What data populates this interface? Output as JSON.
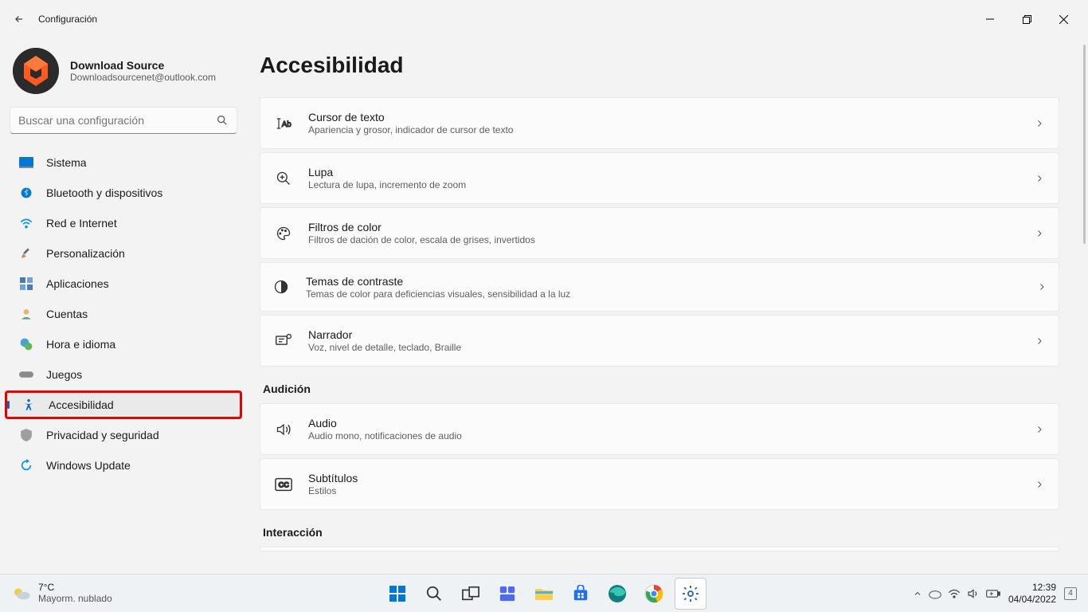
{
  "titlebar": {
    "title": "Configuración"
  },
  "account": {
    "name": "Download Source",
    "email": "Downloadsourcenet@outlook.com"
  },
  "search": {
    "placeholder": "Buscar una configuración"
  },
  "nav": {
    "items": [
      {
        "label": "Sistema"
      },
      {
        "label": "Bluetooth y dispositivos"
      },
      {
        "label": "Red e Internet"
      },
      {
        "label": "Personalización"
      },
      {
        "label": "Aplicaciones"
      },
      {
        "label": "Cuentas"
      },
      {
        "label": "Hora e idioma"
      },
      {
        "label": "Juegos"
      },
      {
        "label": "Accesibilidad"
      },
      {
        "label": "Privacidad y seguridad"
      },
      {
        "label": "Windows Update"
      }
    ]
  },
  "content": {
    "heading": "Accesibilidad",
    "cards": [
      {
        "title": "Cursor de texto",
        "sub": "Apariencia y grosor, indicador de cursor de texto"
      },
      {
        "title": "Lupa",
        "sub": "Lectura de lupa, incremento de zoom"
      },
      {
        "title": "Filtros de color",
        "sub": "Filtros de dación de color, escala de grises, invertidos"
      },
      {
        "title": "Temas de contraste",
        "sub": "Temas de color para deficiencias visuales, sensibilidad a la luz"
      },
      {
        "title": "Narrador",
        "sub": "Voz, nivel de detalle, teclado, Braille"
      }
    ],
    "section_hearing": "Audición",
    "cards_hearing": [
      {
        "title": "Audio",
        "sub": "Audio mono, notificaciones de audio"
      },
      {
        "title": "Subtítulos",
        "sub": "Estilos"
      }
    ],
    "section_interaction": "Interacción"
  },
  "taskbar": {
    "weather": {
      "temp": "7°C",
      "desc": "Mayorm. nublado"
    },
    "clock": {
      "time": "12:39",
      "date": "04/04/2022"
    },
    "notif_count": "4"
  }
}
